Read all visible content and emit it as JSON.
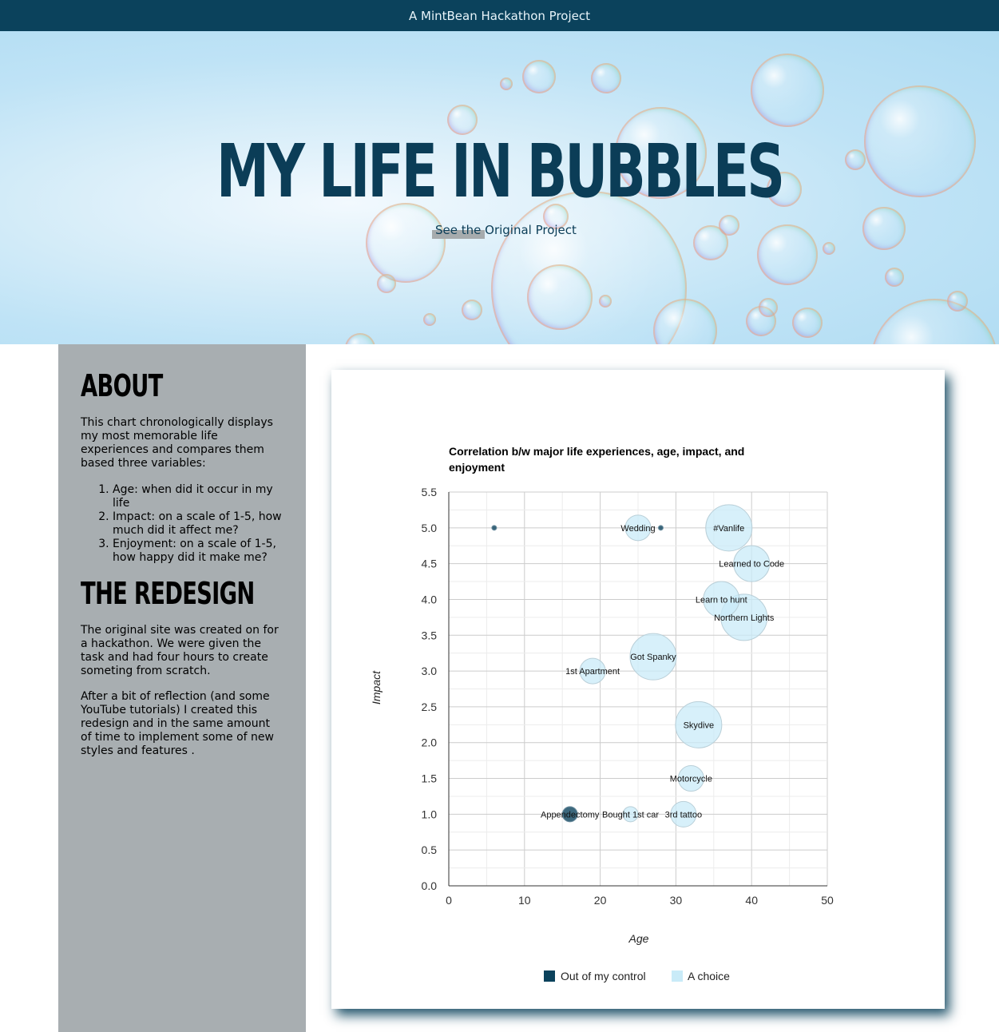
{
  "header": {
    "banner_text": "A MintBean Hackathon Project"
  },
  "hero": {
    "title": "MY LIFE IN BUBBLES",
    "link_label": "See the Original Project"
  },
  "sidebar": {
    "about_heading": "ABOUT",
    "about_text": "This chart chronologically displays my most memorable life experiences and compares them based three variables:",
    "variables": [
      "Age: when did it occur in my life",
      "Impact: on a scale of 1-5, how much did it affect me?",
      "Enjoyment: on a scale of 1-5, how happy did it make me?"
    ],
    "redesign_heading": "THE REDESIGN",
    "redesign_p1": "The original site was created on for a hackathon. We were given the task and had four hours to create someting from scratch.",
    "redesign_p2": "After a bit of reflection (and some YouTube tutorials) I created this redesign and in the same amount of time to implement some of new styles and features ."
  },
  "colors": {
    "brand": "#0b425c",
    "sidebar_bg": "#a8aeb1",
    "out_of_control": "#0b425c",
    "a_choice": "#c9ebf8"
  },
  "chart_data": {
    "type": "scatter",
    "title_lines": [
      "Correlation b/w major life experiences, age, impact, and",
      "enjoyment"
    ],
    "xlabel": "Age",
    "ylabel": "Impact",
    "xlim": [
      0,
      50
    ],
    "ylim": [
      0,
      5.5
    ],
    "x_ticks": [
      "0",
      "10",
      "20",
      "30",
      "40",
      "50"
    ],
    "y_ticks": [
      "0.0",
      "0.5",
      "1.0",
      "1.5",
      "2.0",
      "2.5",
      "3.0",
      "3.5",
      "4.0",
      "4.5",
      "5.0",
      "5.5"
    ],
    "grid": true,
    "legend_position": "bottom",
    "series": [
      {
        "name": "Out of my control",
        "color": "#0b425c"
      },
      {
        "name": "A choice",
        "color": "#c9ebf8"
      }
    ],
    "points": [
      {
        "label": "",
        "age": 6,
        "impact": 5.0,
        "enjoyment": 1,
        "series": "Out of my control"
      },
      {
        "label": "Wedding",
        "age": 25,
        "impact": 5.0,
        "enjoyment": 3,
        "series": "A choice"
      },
      {
        "label": "",
        "age": 28,
        "impact": 5.0,
        "enjoyment": 1,
        "series": "Out of my control"
      },
      {
        "label": "#Vanlife",
        "age": 37,
        "impact": 5.0,
        "enjoyment": 5,
        "series": "A choice"
      },
      {
        "label": "Learned to Code",
        "age": 40,
        "impact": 4.5,
        "enjoyment": 4,
        "series": "A choice"
      },
      {
        "label": "Learn to hunt",
        "age": 36,
        "impact": 4.0,
        "enjoyment": 4,
        "series": "A choice"
      },
      {
        "label": "Northern Lights",
        "age": 39,
        "impact": 3.75,
        "enjoyment": 5,
        "series": "A choice"
      },
      {
        "label": "Got Spanky",
        "age": 27,
        "impact": 3.2,
        "enjoyment": 5,
        "series": "A choice"
      },
      {
        "label": "1st Apartment",
        "age": 19,
        "impact": 3.0,
        "enjoyment": 3,
        "series": "A choice"
      },
      {
        "label": "Skydive",
        "age": 33,
        "impact": 2.25,
        "enjoyment": 5,
        "series": "A choice"
      },
      {
        "label": "Motorcycle",
        "age": 32,
        "impact": 1.5,
        "enjoyment": 3,
        "series": "A choice"
      },
      {
        "label": "Appendectomy",
        "age": 16,
        "impact": 1.0,
        "enjoyment": 2,
        "series": "Out of my control"
      },
      {
        "label": "Bought 1st car",
        "age": 24,
        "impact": 1.0,
        "enjoyment": 2,
        "series": "A choice"
      },
      {
        "label": "3rd tattoo",
        "age": 31,
        "impact": 1.0,
        "enjoyment": 3,
        "series": "A choice"
      }
    ]
  }
}
